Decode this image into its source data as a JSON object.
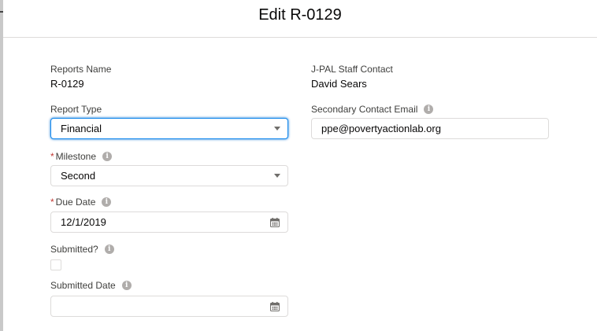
{
  "modal": {
    "title": "Edit R-0129"
  },
  "left": {
    "reports_name": {
      "label": "Reports Name",
      "value": "R-0129"
    },
    "report_type": {
      "label": "Report Type",
      "value": "Financial"
    },
    "milestone": {
      "required_mark": "*",
      "label": "Milestone",
      "value": "Second"
    },
    "due_date": {
      "required_mark": "*",
      "label": "Due Date",
      "value": "12/1/2019"
    },
    "submitted": {
      "label": "Submitted?",
      "checked": false
    },
    "submitted_date": {
      "label": "Submitted Date",
      "value": ""
    }
  },
  "right": {
    "staff_contact": {
      "label": "J-PAL Staff Contact",
      "value": "David Sears"
    },
    "secondary_email": {
      "label": "Secondary Contact Email",
      "value": "ppe@povertyactionlab.org"
    }
  },
  "icons": {
    "info": "info-icon",
    "dropdown": "chevron-down-icon",
    "calendar": "calendar-icon"
  },
  "colors": {
    "required": "#c23934",
    "focus_border": "#1589ee",
    "field_border": "#dddbda",
    "label_text": "#3e3e3c",
    "icon_gray": "#706e6b"
  }
}
